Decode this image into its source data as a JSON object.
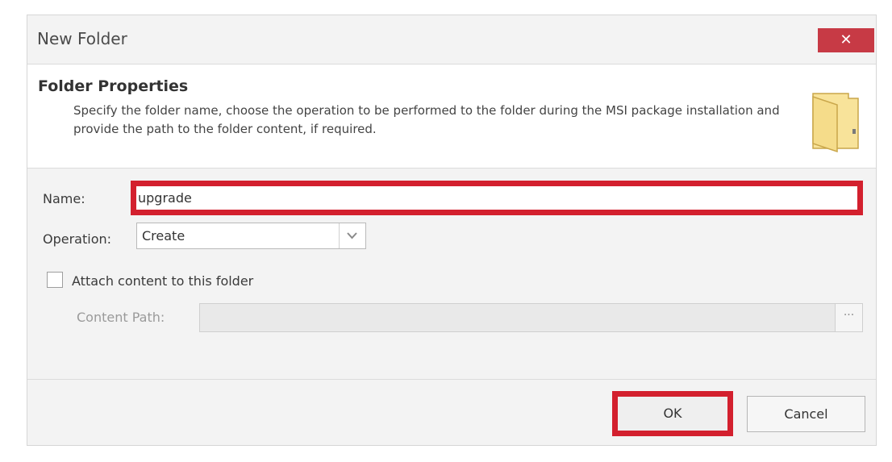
{
  "window": {
    "title": "New Folder",
    "close_glyph": "✕"
  },
  "header": {
    "title": "Folder Properties",
    "description": "Specify the folder name, choose the operation to be performed to the folder during the MSI package installation and provide the path to the folder content, if required.",
    "icon": "folder-icon"
  },
  "form": {
    "name_label": "Name:",
    "name_value": "upgrade",
    "operation_label": "Operation:",
    "operation_value": "Create",
    "attach_label": "Attach content to this folder",
    "attach_checked": false,
    "content_path_label": "Content Path:",
    "content_path_value": "",
    "browse_glyph": "···"
  },
  "buttons": {
    "ok": "OK",
    "cancel": "Cancel"
  },
  "colors": {
    "close_button": "#c73a45",
    "highlight": "#d3202e",
    "folder": "#f5dc8a"
  }
}
